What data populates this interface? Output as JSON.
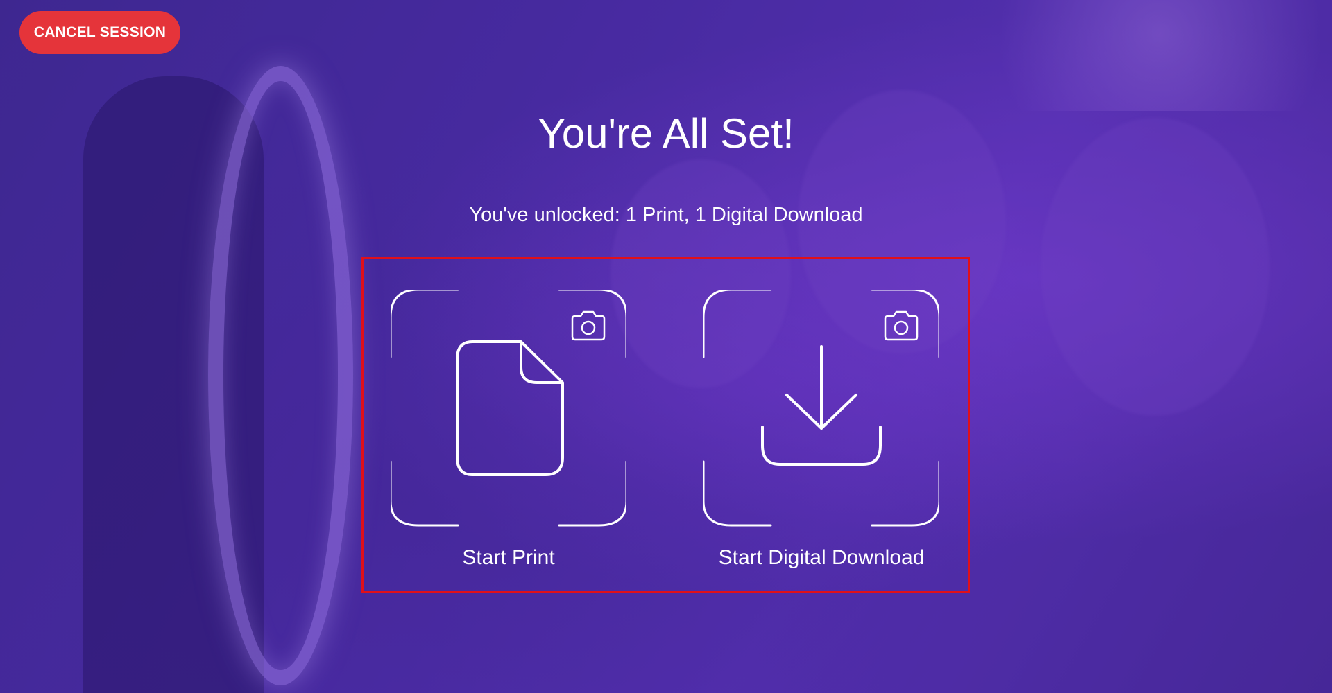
{
  "header": {
    "cancel_label": "CANCEL SESSION"
  },
  "main": {
    "title": "You're All Set!",
    "subtitle": "You've unlocked:  1 Print, 1 Digital Download",
    "options": [
      {
        "label": "Start Print",
        "icon": "document-icon",
        "badge_icon": "camera-icon"
      },
      {
        "label": "Start Digital Download",
        "icon": "download-icon",
        "badge_icon": "camera-icon"
      }
    ]
  },
  "colors": {
    "accent_red": "#e5343a",
    "highlight_border": "#e0101a",
    "background_purple": "#4a2a98",
    "text": "#ffffff"
  }
}
